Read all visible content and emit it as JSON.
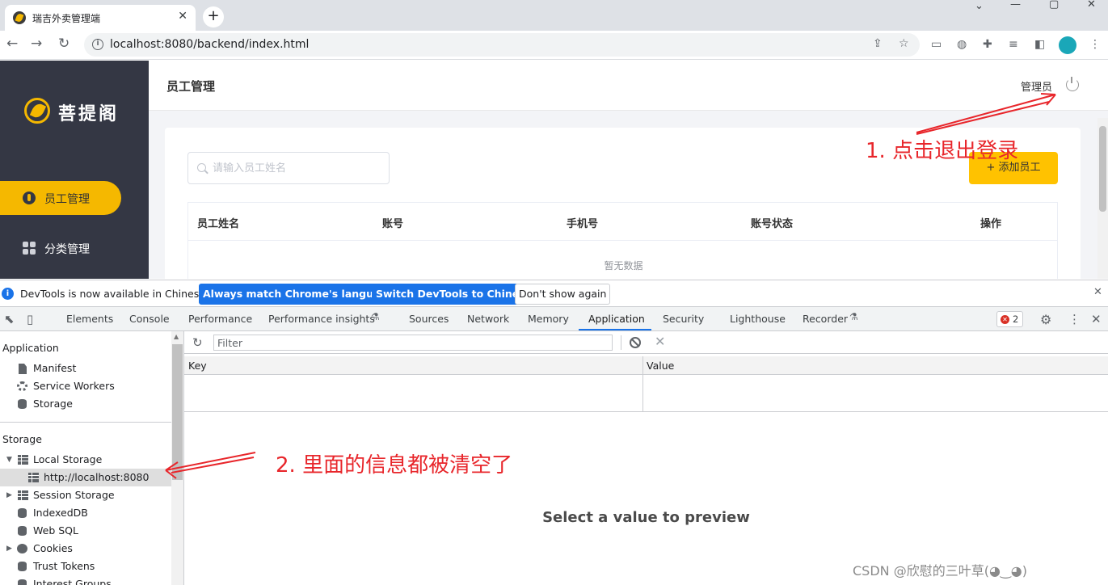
{
  "browser": {
    "tab_title": "瑞吉外卖管理端",
    "tab_close": "✕",
    "new_tab": "+",
    "window_controls": [
      "⌄",
      "—",
      "▢",
      "✕"
    ],
    "url": "localhost:8080/backend/index.html",
    "nav": [
      "←",
      "→",
      "↻"
    ]
  },
  "app": {
    "logo_text": "菩提阁",
    "menu": [
      {
        "label": "员工管理",
        "active": true
      },
      {
        "label": "分类管理",
        "active": false
      }
    ],
    "page_title": "员工管理",
    "admin_name": "管理员",
    "search_placeholder": "请输入员工姓名",
    "add_button": "+ 添加员工",
    "columns": [
      "员工姓名",
      "账号",
      "手机号",
      "账号状态",
      "操作"
    ],
    "empty_text": "暂无数据"
  },
  "devtools": {
    "infobar": {
      "text": "DevTools is now available in Chinese!",
      "btn_match": "Always match Chrome's language",
      "btn_switch": "Switch DevTools to Chinese",
      "btn_dismiss": "Don't show again",
      "close": "✕"
    },
    "tabs": [
      "Elements",
      "Console",
      "Performance",
      "Performance insights",
      "Sources",
      "Network",
      "Memory",
      "Application",
      "Security",
      "Lighthouse",
      "Recorder"
    ],
    "active_tab": "Application",
    "error_count": "2",
    "error_dot": "✕",
    "sidebar": {
      "application_title": "Application",
      "application_items": [
        "Manifest",
        "Service Workers",
        "Storage"
      ],
      "storage_title": "Storage",
      "storage_items": [
        "Local Storage",
        "http://localhost:8080",
        "Session Storage",
        "IndexedDB",
        "Web SQL",
        "Cookies",
        "Trust Tokens",
        "Interest Groups"
      ]
    },
    "filter_placeholder": "Filter",
    "key_header": "Key",
    "value_header": "Value",
    "preview_text": "Select a value to preview"
  },
  "annotations": {
    "note1": "1. 点击退出登录",
    "note2": "2. 里面的信息都被清空了",
    "color": "#e8262b"
  },
  "watermark": "CSDN @欣慰的三叶草(◕‿◕)",
  "colors": {
    "accent": "#ffc200",
    "sidebar_bg": "#343744",
    "devtools_blue": "#1a73e8"
  }
}
